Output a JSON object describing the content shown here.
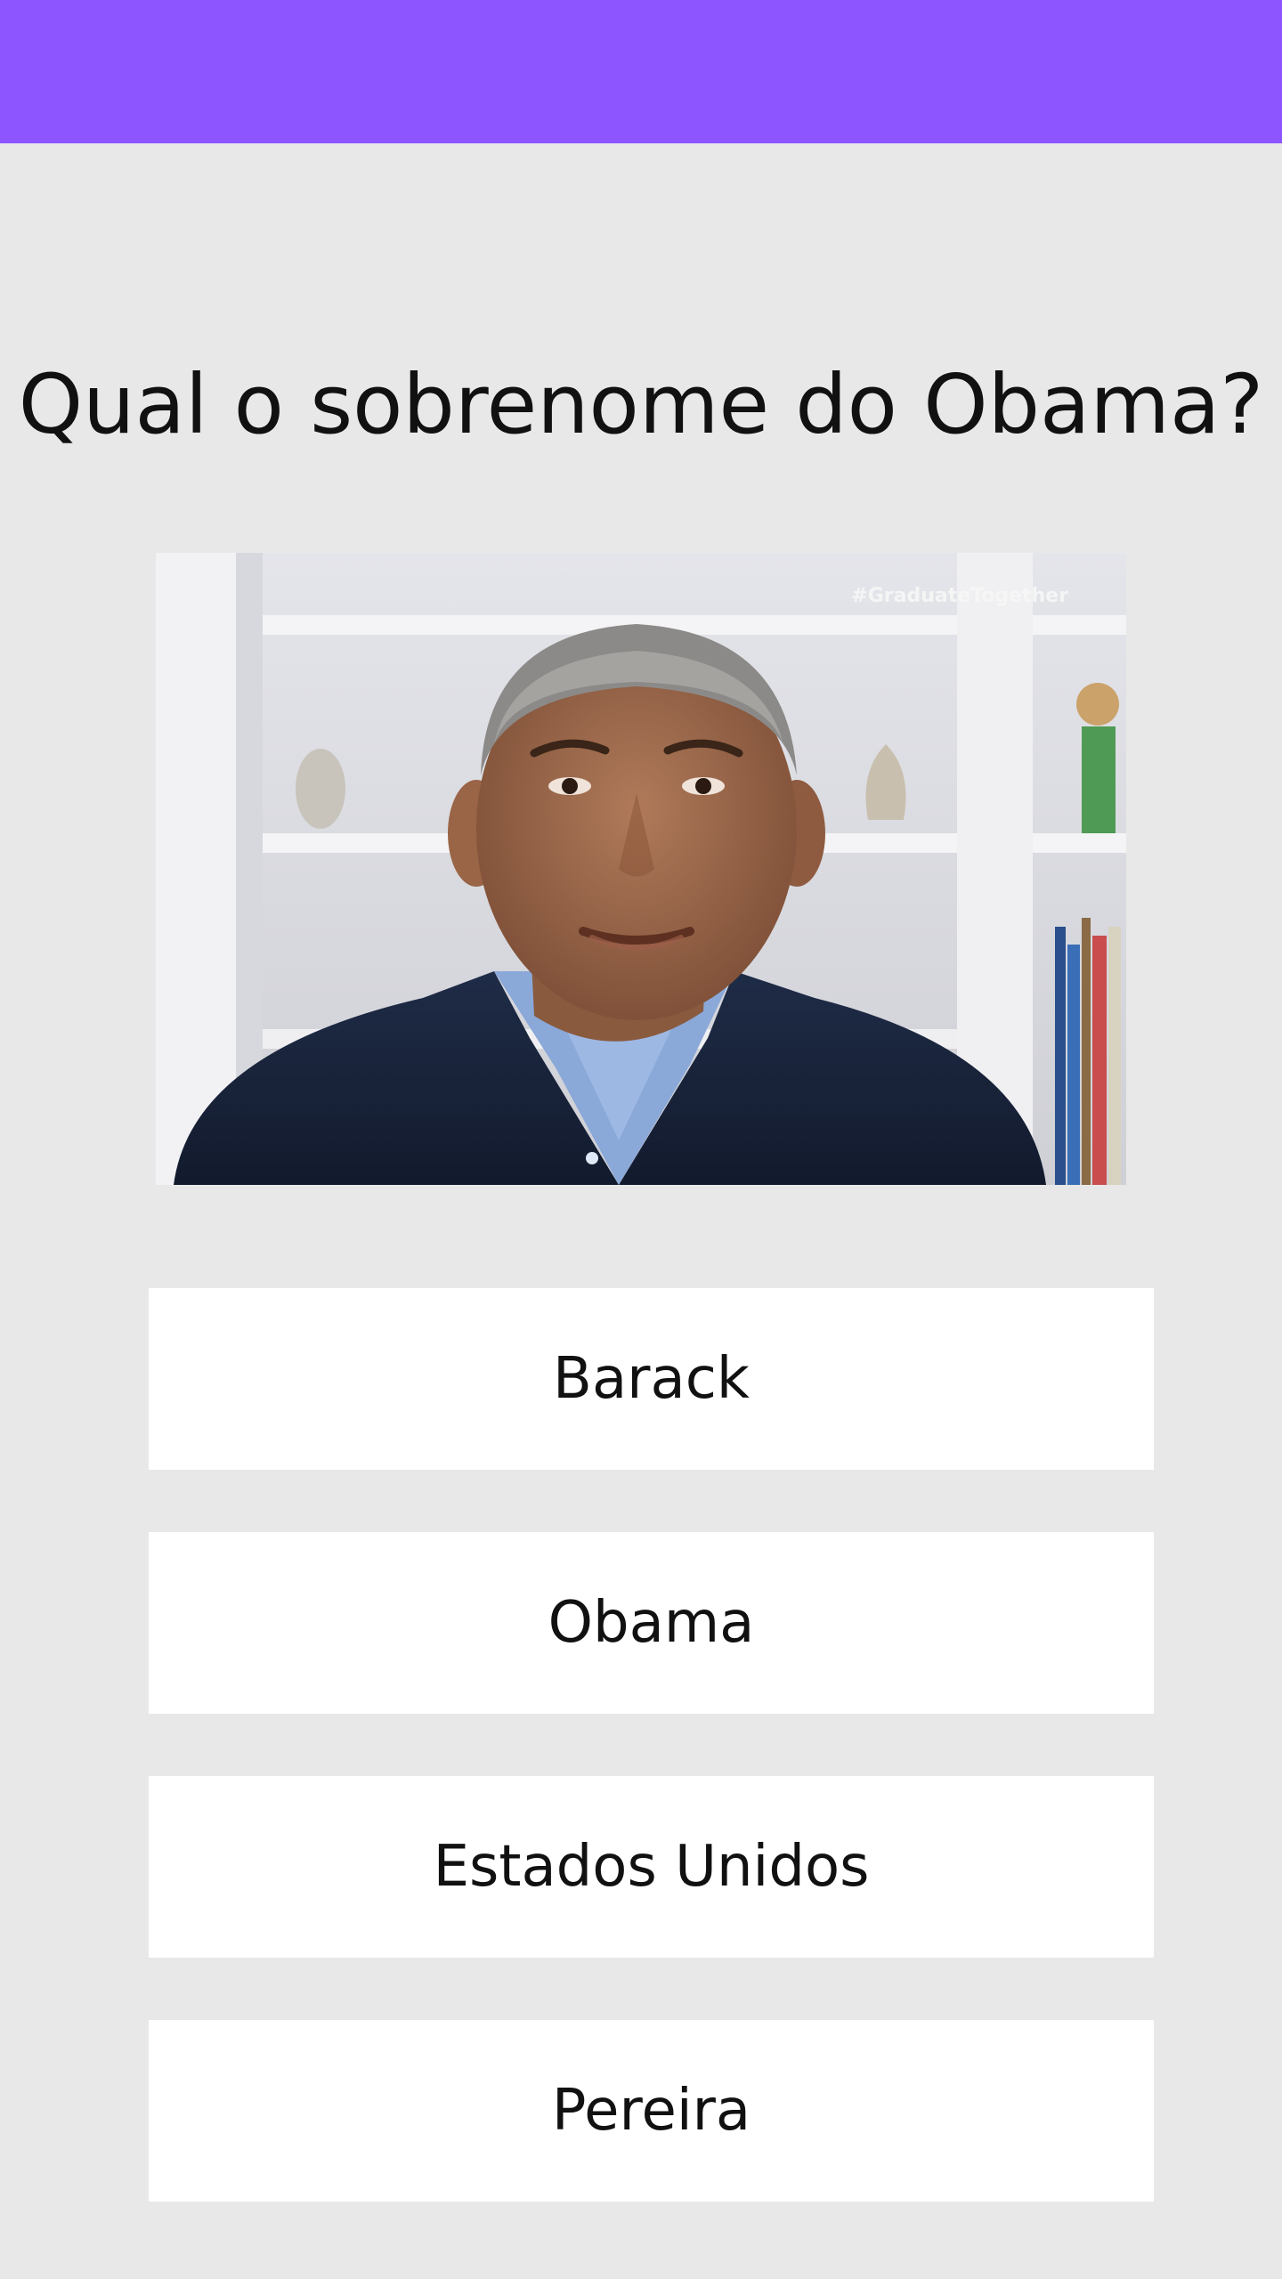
{
  "app_bar": {
    "color": "#8c55ff"
  },
  "quiz": {
    "question": "Qual o sobrenome do Obama?",
    "image": {
      "watermark": "#GraduateTogether"
    },
    "answers": [
      {
        "label": "Barack"
      },
      {
        "label": "Obama"
      },
      {
        "label": "Estados Unidos"
      },
      {
        "label": "Pereira"
      }
    ]
  }
}
